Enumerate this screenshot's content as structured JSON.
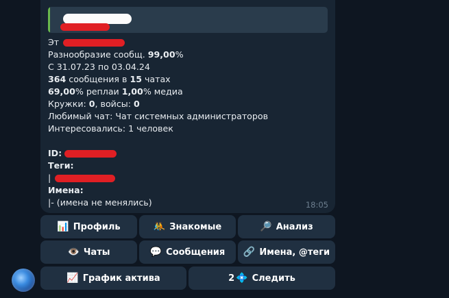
{
  "message": {
    "partial_label": "Эт",
    "diversity_label": "Разнообразие сообщ.",
    "diversity_value": "99,00",
    "diversity_unit": "%",
    "period": "С 31.07.23 по 03.04.24",
    "messages_count": "364",
    "messages_mid": " сообщения в ",
    "chats_count": "15",
    "chats_unit": " чатах",
    "replies_pct": "69,00",
    "replies_mid": "% реплаи ",
    "media_pct": "1,00",
    "media_unit": "% медиа",
    "circles_label": "Кружки: ",
    "circles_value": "0",
    "voices_label": ", войсы: ",
    "voices_value": "0",
    "favorite_chat": "Любимый чат: Чат системных администраторов",
    "interested": "Интересовались: 1 человек",
    "id_label": "ID:",
    "tags_label": "Теги:",
    "tags_prefix": "|",
    "names_label": "Имена:",
    "names_value": "|- (имена не менялись)",
    "time": "18:05"
  },
  "buttons": {
    "profile": {
      "icon": "📊",
      "label": "Профиль"
    },
    "acquaintances": {
      "icon": "🤼",
      "label": "Знакомые"
    },
    "analysis": {
      "icon": "🔎",
      "label": "Анализ"
    },
    "chats": {
      "icon": "👁️",
      "label": "Чаты"
    },
    "messages": {
      "icon": "💬",
      "label": "Сообщения"
    },
    "names_tags": {
      "icon": "🔗",
      "label": "Имена, @теги"
    },
    "activity": {
      "icon": "📈",
      "label": "График актива"
    },
    "follow": {
      "prefix": "2",
      "icon": "💠",
      "label": "Следить"
    }
  },
  "colors": {
    "background": "#0e1621",
    "bubble": "#182533",
    "button": "#203041",
    "redaction": "#e01f24",
    "quote_bar": "#6ab94d"
  }
}
